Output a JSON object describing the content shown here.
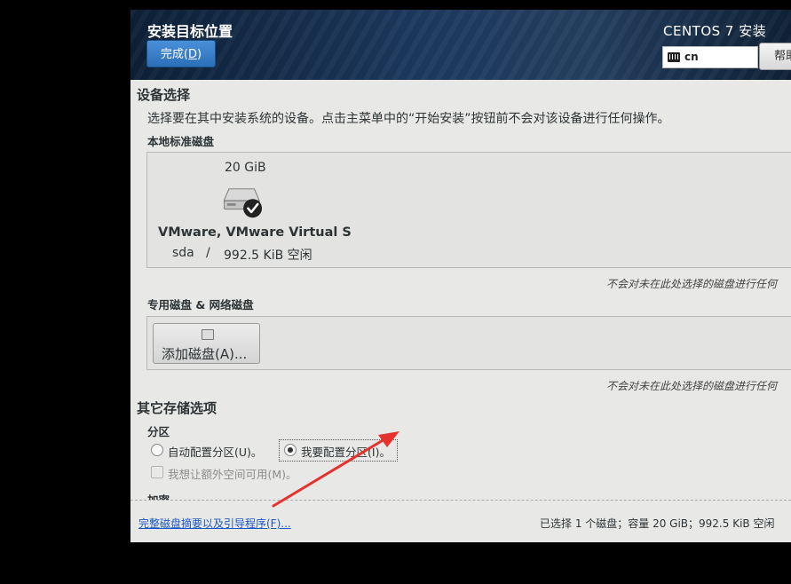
{
  "header": {
    "title": "安装目标位置",
    "done_label": "完成(",
    "done_key": "D",
    "done_close": ")",
    "product": "CENTOS 7 安装",
    "keyboard_layout": "cn",
    "help_label": "帮助"
  },
  "device_selection": {
    "heading": "设备选择",
    "description": "选择要在其中安装系统的设备。点击主菜单中的“开始安装”按钮前不会对该设备进行任何操作。",
    "local_disks_heading": "本地标准磁盘",
    "disk": {
      "size": "20 GiB",
      "name": "VMware, VMware Virtual S",
      "device": "sda",
      "separator": "/",
      "free": "992.5 KiB 空闲"
    },
    "note_local": "不会对未在此处选择的磁盘进行任何",
    "specialized_heading": "专用磁盘 & 网络磁盘",
    "add_disk_label": "添加磁盘(A)...",
    "note_specialized": "不会对未在此处选择的磁盘进行任何"
  },
  "other_storage": {
    "heading": "其它存储选项",
    "partition_heading": "分区",
    "auto_partition": "自动配置分区(U)。",
    "manual_partition": "我要配置分区(I)。",
    "extra_space": "我想让额外空间可用(M)。",
    "encryption_heading": "加密"
  },
  "footer": {
    "summary_link": "完整磁盘摘要以及引导程序(F)...",
    "selection_summary": "已选择 1 个磁盘；容量 20 GiB；992.5 KiB 空闲"
  },
  "colors": {
    "done_button": "#2a6fb8",
    "header_bg": "#1d3a5f",
    "annotation_arrow": "#e5322d",
    "link": "#1a57c4"
  }
}
